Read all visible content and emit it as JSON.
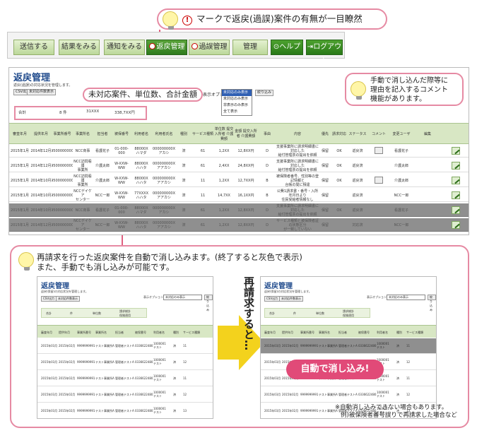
{
  "callout_top": {
    "text": "マークで返戻(過誤)案件の有無が一目瞭然",
    "mark": "!"
  },
  "nav": {
    "items": [
      {
        "label": "送信する"
      },
      {
        "label": "結果をみる"
      },
      {
        "label": "通知をみる"
      },
      {
        "label": "返戻管理"
      },
      {
        "label": "過誤管理"
      },
      {
        "label": "管理"
      },
      {
        "label": "ヘルプ"
      },
      {
        "label": "ログアウト"
      }
    ]
  },
  "main": {
    "title": "返戻管理",
    "description": "返戻(過誤)の対応状況を管理します。",
    "csv_buttons": [
      "CSV出力",
      "未対応件数表示"
    ],
    "option_label": "表示オプション",
    "option_items": [
      "未対応のみ表示",
      "未対応のみ表示",
      "非表示のみ表示",
      "全て表示"
    ],
    "option_go": "絞り込み",
    "summary": {
      "label": "合計",
      "count": "8 件",
      "units": "31XXX",
      "amount": "338,7XX円"
    },
    "callout_summary": "未対応案件、単位数、合計金額",
    "columns": [
      "審査年月",
      "提供年月",
      "事業所番号",
      "事業所名",
      "担当者",
      "被保番号",
      "利用者名",
      "利用者氏名",
      "種別",
      "サービス種類",
      "単位数\n提交入所者\n介護費額",
      "金額\n提交入所者\n介護費額",
      "事由",
      "内容",
      "優先",
      "請求対応",
      "ステータス",
      "コメント",
      "変更ユーザ",
      "編集"
    ],
    "rows": [
      [
        "2015年1月",
        "2014年12月",
        "9500000000",
        "NCC商事",
        "看護花子",
        "01-000-000",
        "88000X\nハマダ",
        "000000000X\nアカシ",
        "済",
        "61",
        "1,2XX",
        "12,8XX円",
        "D",
        "支援事業所に請求明細書に対応した\n給付管理票の提出を依頼",
        "保留",
        "OK",
        "返戻済",
        "",
        "看護花子"
      ],
      [
        "2015年1月",
        "2014年12月",
        "9500000000",
        "NCC訪問看護\n事業所",
        "介護太郎",
        "W-XXW-WW",
        "88000X\nハハタ",
        "000000000X\nアアカシ",
        "済",
        "61",
        "2,4XX",
        "24,8XX円",
        "D",
        "支援事業所に請求明細書に対応した\n給付管理票の提出を依頼",
        "保留",
        "OK",
        "返戻済",
        "",
        "介護太郎"
      ],
      [
        "2015年1月",
        "2014年10月",
        "9500000000",
        "NCC訪問看護\n事業所",
        "介護太郎",
        "W-XXW-WW",
        "88000X\nハハタ",
        "000000000X\nアアカシ",
        "済",
        "11",
        "1,2XX",
        "12,7XX円",
        "B",
        "被保険者番号、性別等の登記情報と\n台帳の間に相違",
        "保留",
        "OK",
        "返戻済",
        "",
        "介護太郎"
      ],
      [
        "2015年1月",
        "2014年10月",
        "9500000000",
        "NCCデイケア\nセンター",
        "NCC一郎",
        "W-XXW-WW",
        "77XXXX\nハハタ",
        "000000000X\nアアカシ",
        "済",
        "11",
        "14,7XX",
        "16,1XX円",
        "B",
        "公費1請求書・番号・入所年月日より\n住民受給者情報なし",
        "保留",
        "",
        "返戻済",
        "",
        "NCC一郎"
      ],
      [
        "2015年1月",
        "2014年10月",
        "9500000000",
        "NCC商事",
        "看護花子",
        "01-000-000",
        "88000X\nハマダ",
        "000000000X\nアカシ",
        "済",
        "61",
        "1,2XX",
        "12,8XX円",
        "D",
        "支援事業所に請求明細書に対応した\n給付管理票の提出を依頼",
        "保留",
        "OK",
        "返戻済",
        "",
        "看護花子"
      ],
      [
        "2015年1月",
        "2014年12月",
        "9500000000",
        "NCCデイケア\nセンター",
        "NCC一郎",
        "W-XXW-WW",
        "88000X\nハハタ",
        "000000000X\nアアカシ",
        "済",
        "61",
        "1,2XX",
        "12,8XX円",
        "D",
        "サービス種類と被保険者証の状態区分\nが一致していない",
        "保留",
        "",
        "対応済",
        "",
        "NCC一郎"
      ]
    ]
  },
  "callout_comment": "手動で消し込んだ際等に\n理由を記入するコメント\n機能があります。",
  "panel": {
    "line1": "再請求を行った返戻案件を自動で消し込みます。(終了すると灰色で表示)",
    "line2": "また、手動でも消し込みが可能です。",
    "arrow_text": "再請求すると…",
    "badge": "自動で消し込み!",
    "note_line1": "※自動消し込みできない場合もあります。",
    "note_line2": "例)被保険者番号誤りで再請求した場合など"
  },
  "mini": {
    "title": "返戻管理",
    "description": "返戻(保留)の対応状況を管理します。",
    "csv": "CSV出力",
    "csv2": "未対応件数表示",
    "option_label": "表示オプション",
    "option_value": "未対応のみ表示",
    "go": "絞り込み",
    "summary": [
      "合計",
      "件",
      "単位数",
      "請求総計\n保険適用"
    ],
    "columns": [
      "審査年月",
      "提供年月",
      "事業所番号",
      "事業所名",
      "担当者",
      "被保番号",
      "利用者名",
      "種別",
      "サービス種類"
    ],
    "rows": [
      [
        "2015年03月",
        "2015年02月",
        "9999999991",
        "テスト事業所A",
        "管理者テストA",
        "0336622480",
        "1000001\nテスト",
        "済",
        "11"
      ],
      [
        "2015年03月",
        "2015年02月",
        "9999999991",
        "テスト事業所A",
        "管理者テストA",
        "0336622480",
        "1000001\nテスト",
        "済",
        "12"
      ],
      [
        "2015年03月",
        "2015年02月",
        "9999999991",
        "テスト事業所A",
        "管理者テストA",
        "0336622480",
        "1000001\nテスト",
        "済",
        "11"
      ],
      [
        "2015年03月",
        "2015年02月",
        "9999999991",
        "テスト事業所A",
        "管理者テストA",
        "0336622480",
        "1000001\nテスト",
        "済",
        "12"
      ],
      [
        "2015年03月",
        "2015年02月",
        "9999999991",
        "テスト事業所A",
        "管理者テストA",
        "0336622480",
        "1000001\nテスト",
        "済",
        "13"
      ]
    ]
  }
}
